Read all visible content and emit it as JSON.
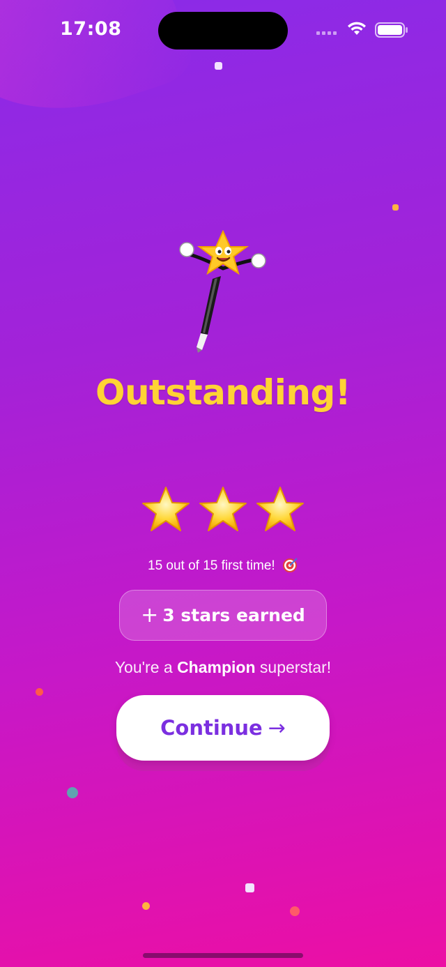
{
  "status_bar": {
    "time": "17:08"
  },
  "title": "Outstanding!",
  "stars": {
    "earned": 3,
    "total": 3
  },
  "score_text": "15 out of 15 first time!",
  "earned_pill": {
    "plus": "+",
    "text": "3 stars earned"
  },
  "champion": {
    "prefix": "You're a ",
    "rank": "Champion",
    "suffix": " superstar!"
  },
  "continue": {
    "label": "Continue",
    "arrow": "→"
  },
  "colors": {
    "title": "#ffd335",
    "button_text": "#7b2fe0",
    "gradient_top": "#8a2be8",
    "gradient_bottom": "#ec0fa4"
  },
  "icons": {
    "mascot": "star-pencil-mascot-icon",
    "star": "star-icon",
    "target": "target-dart-icon",
    "arrow": "arrow-right-icon"
  }
}
